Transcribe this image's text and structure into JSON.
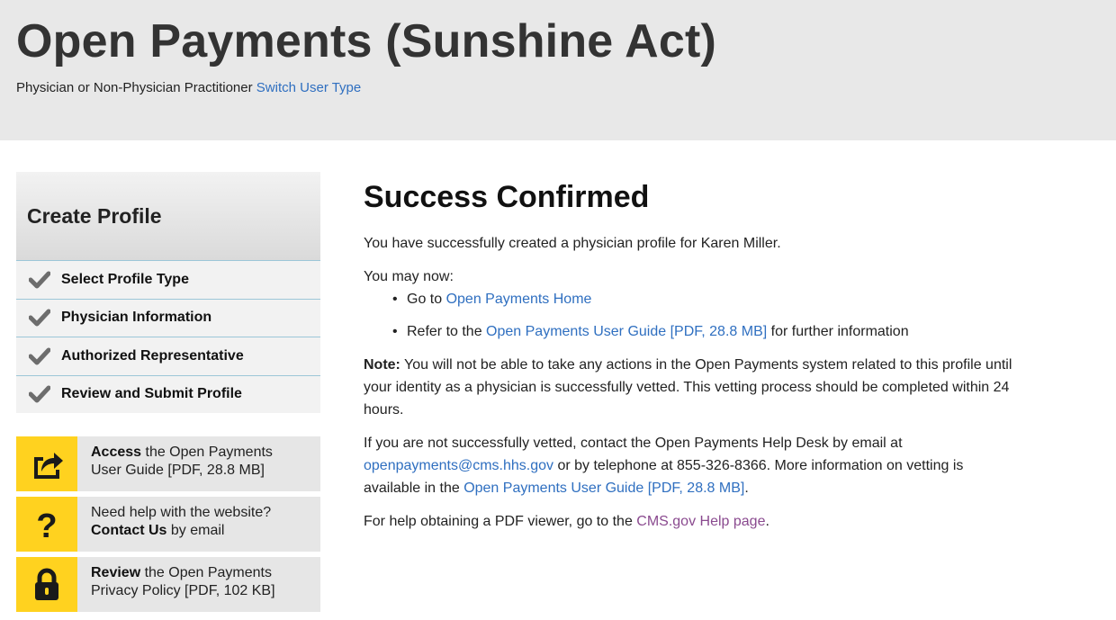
{
  "header": {
    "title": "Open Payments (Sunshine Act)",
    "user_type": "Physician or Non-Physician Practitioner",
    "switch_link": "Switch User Type"
  },
  "sidebar": {
    "heading": "Create Profile",
    "steps": [
      {
        "label": "Select Profile Type",
        "icon": "checkmark-icon"
      },
      {
        "label": "Physician Information",
        "icon": "checkmark-icon"
      },
      {
        "label": "Authorized Representative",
        "icon": "checkmark-icon"
      },
      {
        "label": "Review and Submit Profile",
        "icon": "checkmark-icon"
      }
    ],
    "help_boxes": [
      {
        "icon": "share-arrow-icon",
        "bold": "Access",
        "line1_rest": " the Open Payments",
        "line2": "User Guide [PDF, 28.8 MB]"
      },
      {
        "icon": "question-mark-icon",
        "line1": "Need help with the website?",
        "bold": "Contact Us",
        "line2_rest": " by email"
      },
      {
        "icon": "lock-icon",
        "bold": "Review",
        "line1_rest": " the Open Payments",
        "line2": "Privacy Policy [PDF, 102 KB]"
      }
    ]
  },
  "main": {
    "title": "Success Confirmed",
    "confirmation": "You have successfully created a physician profile for Karen Miller.",
    "may_now": "You may now:",
    "bullet1_prefix": "Go to ",
    "bullet1_link": "Open Payments Home",
    "bullet2_prefix": "Refer to the ",
    "bullet2_link": "Open Payments User Guide [PDF, 28.8 MB]",
    "bullet2_suffix": " for further information",
    "note_label": "Note:",
    "note_text": " You will not be able to take any actions in the Open Payments system related to this profile until your identity as a physician is successfully vetted. This vetting process should be completed within 24 hours.",
    "vet_prefix": "If you are not successfully vetted, contact the Open Payments Help Desk by email at ",
    "vet_email": "openpayments@cms.hhs.gov",
    "vet_middle": " or by telephone at 855-326-8366. More information on vetting is available in the ",
    "vet_link": "Open Payments User Guide [PDF, 28.8 MB]",
    "vet_suffix": ".",
    "pdf_prefix": "For help obtaining a PDF viewer, go to the ",
    "pdf_link": "CMS.gov Help page",
    "pdf_suffix": "."
  },
  "colors": {
    "header_bg": "#e8e8e8",
    "link": "#2f6fc0",
    "visited_link": "#8a4a8f",
    "icon_bg": "#ffd21f",
    "step_border": "#9cc6d8"
  }
}
